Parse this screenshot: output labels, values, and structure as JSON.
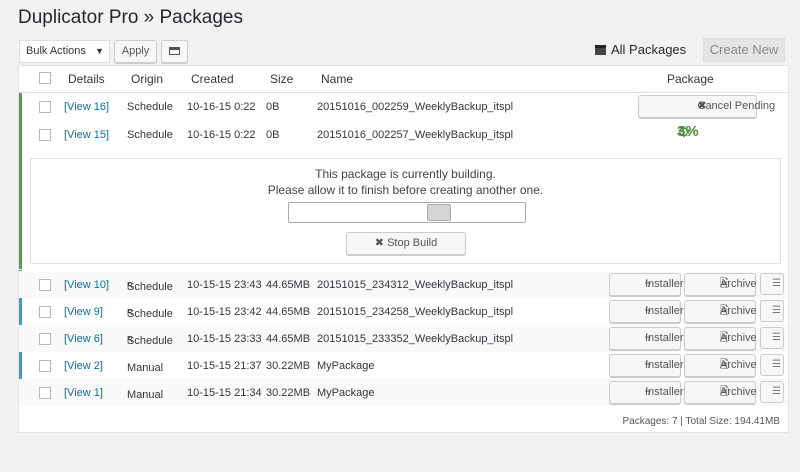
{
  "page": {
    "title": "Duplicator Pro » Packages"
  },
  "toolbar": {
    "bulk_actions": "Bulk Actions",
    "apply_label": "Apply",
    "all_packages_label": "All Packages",
    "create_new_label": "Create New"
  },
  "table": {
    "headers": {
      "details": "Details",
      "origin": "Origin",
      "created": "Created",
      "size": "Size",
      "name": "Name",
      "package": "Package"
    },
    "pending_rows": [
      {
        "details": "[View 16]",
        "origin": "Schedule",
        "created": "10-16-15 0:22",
        "size": "0B",
        "name": "20151016_002259_WeeklyBackup_itspl",
        "action": "Cancel Pending"
      },
      {
        "details": "[View 15]",
        "origin": "Schedule",
        "created": "10-16-15 0:22",
        "size": "0B",
        "name": "20151016_002257_WeeklyBackup_itspl",
        "progress": "3%"
      }
    ],
    "build": {
      "line1": "This package is currently building.",
      "line2": "Please allow it to finish before creating another one.",
      "stop_label": "Stop Build",
      "progress_fraction": 0.65
    },
    "rows": [
      {
        "details": "[View 10]",
        "origin": "Schedule",
        "sup": "R",
        "created": "10-15-15 23:43",
        "size": "44.65MB",
        "name": "20151015_234312_WeeklyBackup_itspl"
      },
      {
        "details": "[View 9]",
        "origin": "Schedule",
        "sup": "R",
        "created": "10-15-15 23:42",
        "size": "44.65MB",
        "name": "20151015_234258_WeeklyBackup_itspl"
      },
      {
        "details": "[View 6]",
        "origin": "Schedule",
        "sup": "R",
        "created": "10-15-15 23:33",
        "size": "44.65MB",
        "name": "20151015_233352_WeeklyBackup_itspl"
      },
      {
        "details": "[View 2]",
        "origin": "Manual",
        "sup": "",
        "created": "10-15-15 21:37",
        "size": "30.22MB",
        "name": "MyPackage"
      },
      {
        "details": "[View 1]",
        "origin": "Manual",
        "sup": "",
        "created": "10-15-15 21:34",
        "size": "30.22MB",
        "name": "MyPackage"
      }
    ],
    "installer_label": "Installer",
    "archive_label": "Archive"
  },
  "footer": {
    "summary": "Packages: 7 | Total Size: 194.41MB"
  },
  "colors": {
    "accent_green": "#4fa24d",
    "accent_blue": "#2ea2cc",
    "link": "#0073aa"
  }
}
